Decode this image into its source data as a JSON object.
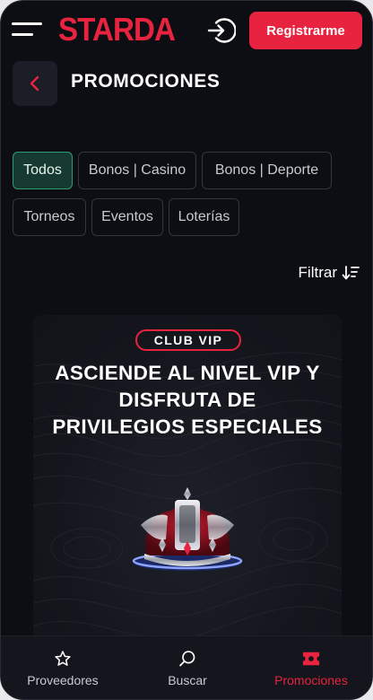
{
  "header": {
    "logo": "STARDA",
    "register_label": "Registrarme"
  },
  "page": {
    "title": "PROMOCIONES"
  },
  "filters": {
    "chips": [
      {
        "label": "Todos",
        "active": true
      },
      {
        "label": "Bonos | Casino",
        "active": false
      },
      {
        "label": "Bonos | Deporte",
        "active": false
      },
      {
        "label": "Torneos",
        "active": false
      },
      {
        "label": "Eventos",
        "active": false
      },
      {
        "label": "Loterías",
        "active": false
      }
    ],
    "sort_label": "Filtrar"
  },
  "promo": {
    "badge": "CLUB VIP",
    "title_lines": [
      "ASCIENDE AL NIVEL VIP Y",
      "DISFRUTA DE",
      "PRIVILEGIOS ESPECIALES"
    ],
    "image": "crown-icon"
  },
  "bottom_nav": {
    "items": [
      {
        "label": "Proveedores",
        "icon": "star-icon",
        "active": false
      },
      {
        "label": "Buscar",
        "icon": "search-icon",
        "active": false
      },
      {
        "label": "Promociones",
        "icon": "ticket-icon",
        "active": true
      }
    ]
  },
  "colors": {
    "background": "#0d0e13",
    "brand": "#e8233f",
    "active_chip_bg": "#173a30",
    "active_chip_border": "#2f9b74"
  }
}
